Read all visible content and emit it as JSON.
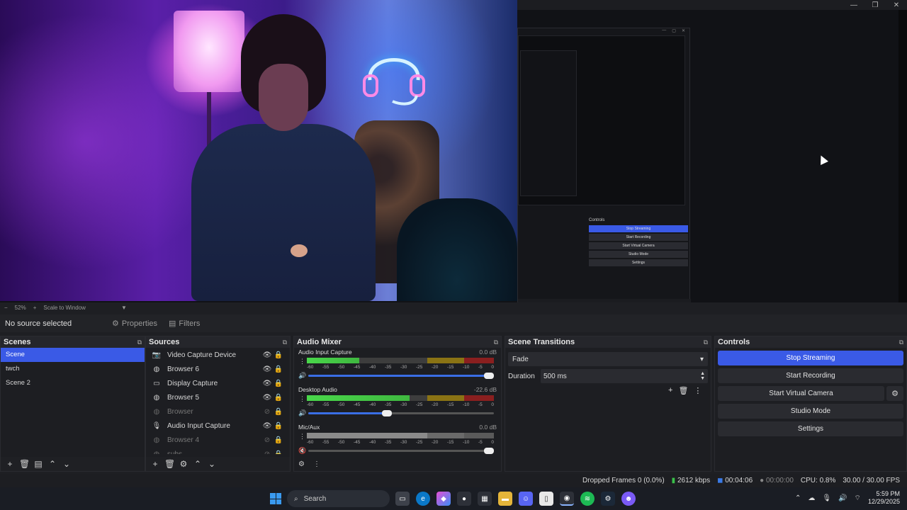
{
  "window": {
    "minimize_glyph": "—",
    "maximize_glyph": "❐",
    "close_glyph": "✕"
  },
  "scale_bar": {
    "zoom": "52%",
    "mode": "Scale to Window"
  },
  "source_toolbar": {
    "status": "No source selected",
    "properties_label": "Properties",
    "filters_label": "Filters"
  },
  "nested": {
    "controls_title": "Controls",
    "buttons": [
      "Stop Streaming",
      "Start Recording",
      "Start Virtual Camera",
      "Studio Mode",
      "Settings"
    ]
  },
  "scenes": {
    "title": "Scenes",
    "items": [
      "Scene",
      "twch",
      "Scene 2"
    ],
    "active_index": 0
  },
  "sources": {
    "title": "Sources",
    "items": [
      {
        "label": "Video Capture Device",
        "icon": "camera-icon",
        "visible": true
      },
      {
        "label": "Browser 6",
        "icon": "globe-icon",
        "visible": true
      },
      {
        "label": "Display Capture",
        "icon": "monitor-icon",
        "visible": true
      },
      {
        "label": "Browser 5",
        "icon": "globe-icon",
        "visible": true
      },
      {
        "label": "Browser",
        "icon": "globe-icon",
        "visible": false
      },
      {
        "label": "Audio Input Capture",
        "icon": "microphone-icon",
        "visible": true
      },
      {
        "label": "Browser 4",
        "icon": "globe-icon",
        "visible": false
      },
      {
        "label": "subs",
        "icon": "globe-icon",
        "visible": false
      }
    ]
  },
  "mixer": {
    "title": "Audio Mixer",
    "scale": [
      "-60",
      "-55",
      "-50",
      "-45",
      "-40",
      "-35",
      "-30",
      "-25",
      "-20",
      "-15",
      "-10",
      "-5",
      "0"
    ],
    "channels": [
      {
        "name": "Audio Input Capture",
        "db": "0.0 dB",
        "level": 0.28,
        "volume": 1.0,
        "muted": false
      },
      {
        "name": "Desktop Audio",
        "db": "-22.6 dB",
        "level": 0.55,
        "volume": 0.45,
        "muted": false
      },
      {
        "name": "Mic/Aux",
        "db": "0.0 dB",
        "level": 0.83,
        "volume": 1.0,
        "muted": true
      }
    ]
  },
  "transitions": {
    "title": "Scene Transitions",
    "selected": "Fade",
    "duration_label": "Duration",
    "duration_value": "500 ms"
  },
  "controls": {
    "title": "Controls",
    "stop_streaming": "Stop Streaming",
    "start_recording": "Start Recording",
    "start_virtual_camera": "Start Virtual Camera",
    "studio_mode": "Studio Mode",
    "settings": "Settings"
  },
  "status": {
    "dropped_frames": "Dropped Frames 0 (0.0%)",
    "bitrate": "2612 kbps",
    "stream_time": "00:04:06",
    "record_time": "00:00:00",
    "cpu": "CPU: 0.8%",
    "fps": "30.00 / 30.00 FPS"
  },
  "taskbar": {
    "search_label": "Search",
    "time": "5:59 PM",
    "date": "12/29/2025"
  },
  "colors": {
    "accent": "#3a5ae6",
    "meter_green": "#49d74a",
    "meter_yellow": "#8a7314",
    "meter_red": "#8a1f1f",
    "signal_green": "#3ac04a"
  }
}
